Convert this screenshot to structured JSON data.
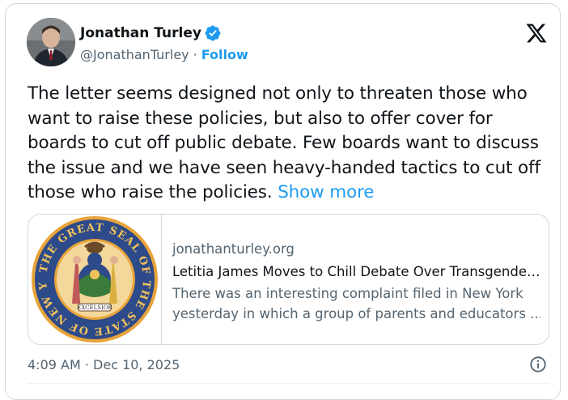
{
  "author": {
    "name": "Jonathan Turley",
    "handle": "@JonathanTurley",
    "separator": "·",
    "follow_label": "Follow"
  },
  "icons": {
    "verified": "verified-badge-icon",
    "platform": "x-logo-icon",
    "info": "info-icon"
  },
  "colors": {
    "accent": "#1d9bf0",
    "text": "#0f1419",
    "secondary": "#536471",
    "border": "#cfd9de"
  },
  "tweet": {
    "text": "The letter seems designed not only to threaten those who want to raise these policies, but also to offer cover for boards to cut off public debate. Few boards want to discuss the issue and we have seen heavy-handed tactics to cut off those who raise the policies.",
    "show_more": "Show more"
  },
  "link_card": {
    "domain": "jonathanturley.org",
    "title": "Letitia James Moves to Chill Debate Over Transgender Policies in Schools",
    "description_line1": "There was an interesting complaint filed in New York",
    "description_line2": "yesterday in which a group of parents and educators ...",
    "seal_text": "THE GREAT SEAL OF THE STATE OF NEW YORK",
    "seal_motto": "EXCELSIOR"
  },
  "timestamp": "4:09 AM · Dec 10, 2025"
}
